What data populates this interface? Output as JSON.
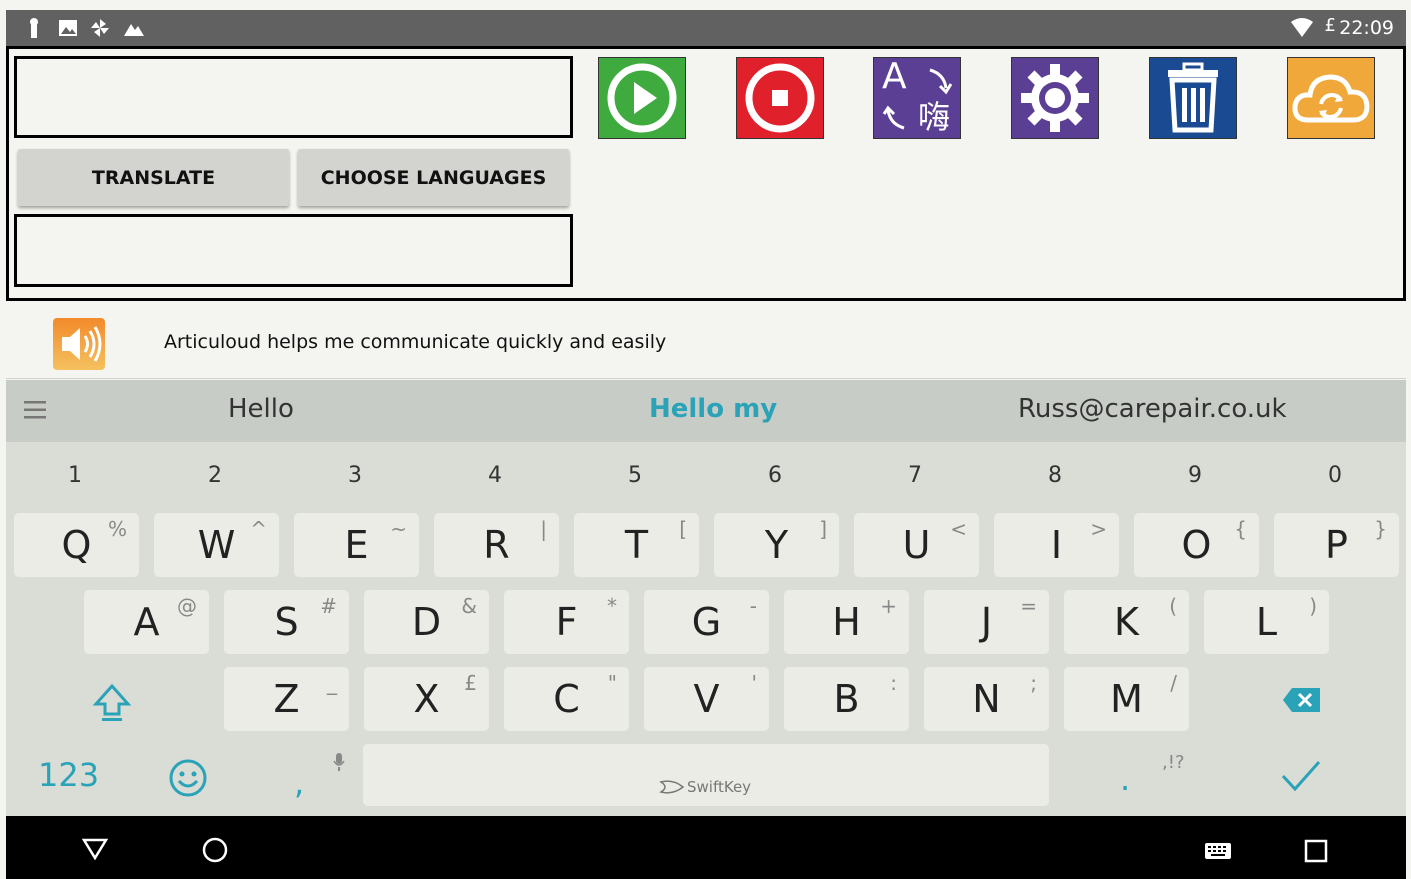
{
  "status": {
    "time": "22:09",
    "battery_glyph": "£"
  },
  "toolbar": {
    "translate_label": "TRANSLATE",
    "choose_languages_label": "CHOOSE LANGUAGES",
    "translate_icon_a": "A",
    "translate_icon_b": "嗨"
  },
  "colors": {
    "play": "#3fab3f",
    "stop": "#e0202a",
    "translate": "#5b3f95",
    "settings": "#5b3f95",
    "delete": "#1a4a92",
    "cloud": "#f0a83a"
  },
  "phrase": {
    "text": "Articuloud helps me communicate quickly and easily"
  },
  "keyboard": {
    "suggestions": [
      "Hello",
      "Hello my",
      "Russ@carepair.co.uk"
    ],
    "numbers": [
      "1",
      "2",
      "3",
      "4",
      "5",
      "6",
      "7",
      "8",
      "9",
      "0"
    ],
    "row1": [
      {
        "k": "Q",
        "a": "%"
      },
      {
        "k": "W",
        "a": "^"
      },
      {
        "k": "E",
        "a": "~"
      },
      {
        "k": "R",
        "a": "|"
      },
      {
        "k": "T",
        "a": "["
      },
      {
        "k": "Y",
        "a": "]"
      },
      {
        "k": "U",
        "a": "<"
      },
      {
        "k": "I",
        "a": ">"
      },
      {
        "k": "O",
        "a": "{"
      },
      {
        "k": "P",
        "a": "}"
      }
    ],
    "row2": [
      {
        "k": "A",
        "a": "@"
      },
      {
        "k": "S",
        "a": "#"
      },
      {
        "k": "D",
        "a": "&"
      },
      {
        "k": "F",
        "a": "*"
      },
      {
        "k": "G",
        "a": "-"
      },
      {
        "k": "H",
        "a": "+"
      },
      {
        "k": "J",
        "a": "="
      },
      {
        "k": "K",
        "a": "("
      },
      {
        "k": "L",
        "a": ")"
      }
    ],
    "row3": [
      {
        "k": "Z",
        "a": "_"
      },
      {
        "k": "X",
        "a": "£"
      },
      {
        "k": "C",
        "a": "\""
      },
      {
        "k": "V",
        "a": "'"
      },
      {
        "k": "B",
        "a": ":"
      },
      {
        "k": "N",
        "a": ";"
      },
      {
        "k": "M",
        "a": "/"
      }
    ],
    "numbers_key": "123",
    "comma": ",",
    "period": ".",
    "punct_alt": ",!?",
    "space_brand": "SwiftKey"
  }
}
